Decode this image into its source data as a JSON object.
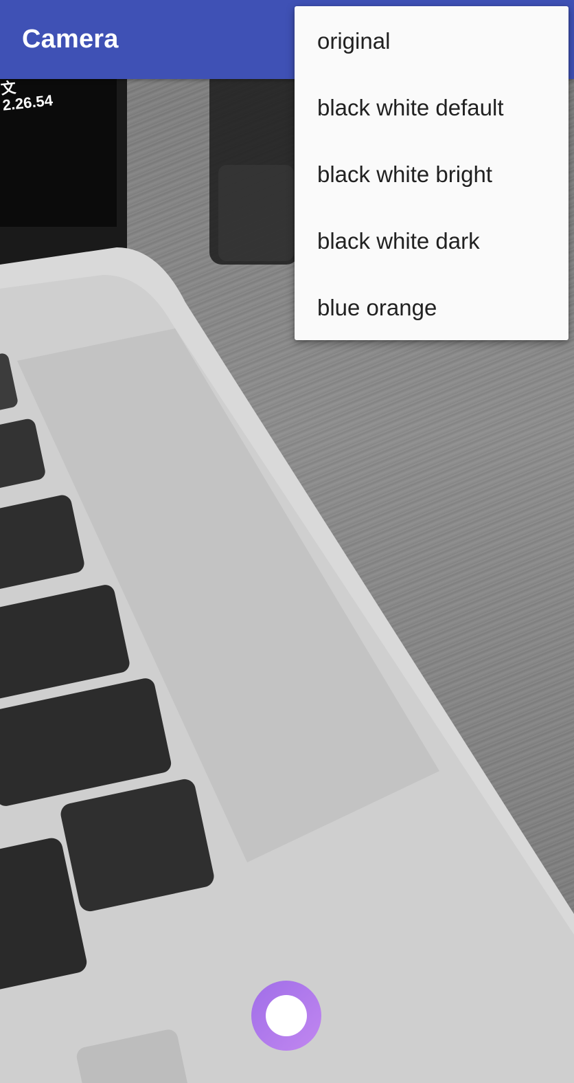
{
  "app_bar": {
    "title": "Camera",
    "color": "#3f51b5"
  },
  "camera_preview": {
    "overlay_lines": [
      "文",
      "2.26.54"
    ]
  },
  "filter_menu": {
    "items": [
      {
        "label": "original"
      },
      {
        "label": "black white default"
      },
      {
        "label": "black white bright"
      },
      {
        "label": "black white dark"
      },
      {
        "label": "blue orange"
      }
    ]
  },
  "shutter": {
    "icon": "shutter-icon",
    "ring_color": "#a877ec"
  }
}
